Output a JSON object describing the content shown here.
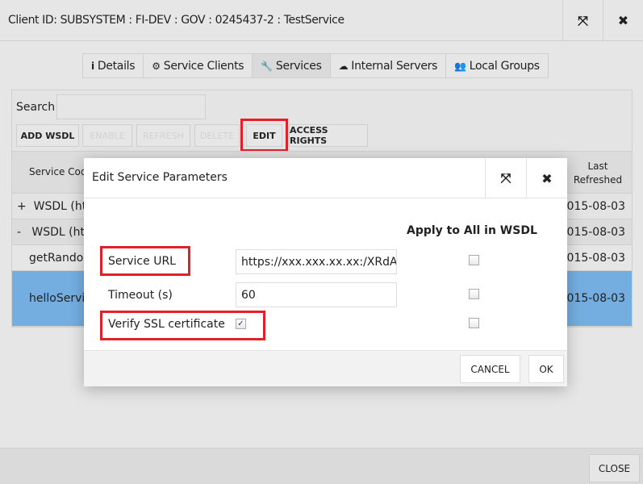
{
  "header": {
    "title_label": "Client ID:",
    "title_value": " SUBSYSTEM : FI-DEV : GOV : 0245437-2 : TestService",
    "maximize_icon": "expand-icon",
    "close_icon": "close-icon"
  },
  "tabs": [
    {
      "label": "Details",
      "icon": "info-icon",
      "glyph": "ℹ"
    },
    {
      "label": "Service Clients",
      "icon": "gears-icon",
      "glyph": "⚙"
    },
    {
      "label": "Services",
      "icon": "wrench-icon",
      "glyph": "🔧",
      "active": true
    },
    {
      "label": "Internal Servers",
      "icon": "cloud-icon",
      "glyph": "☁"
    },
    {
      "label": "Local Groups",
      "icon": "users-icon",
      "glyph": "👥"
    }
  ],
  "toolbar": {
    "search_label": "Search",
    "search_value": "",
    "add_wsdl": "ADD WSDL",
    "enable": "ENABLE",
    "refresh": "REFRESH",
    "delete": "DELETE",
    "edit": "EDIT",
    "access_rights": "ACCESS RIGHTS"
  },
  "table": {
    "columns": [
      "Service Code",
      "Last Refreshed"
    ],
    "rows": [
      {
        "prefix": "+",
        "name": "WSDL (htt",
        "refreshed": "015-08-03"
      },
      {
        "prefix": "-",
        "name": "WSDL (htt",
        "refreshed": "015-08-03"
      },
      {
        "prefix": "",
        "name": "getRandor",
        "refreshed": "015-08-03"
      },
      {
        "prefix": "",
        "name": "helloServi",
        "refreshed": "015-08-03",
        "selected": true
      }
    ]
  },
  "modal": {
    "title": "Edit Service Parameters",
    "apply_header": "Apply to All in WSDL",
    "service_url_label": "Service URL",
    "service_url_value": "https://xxx.xxx.xx.xx:/XRdA",
    "timeout_label": "Timeout (s)",
    "timeout_value": "60",
    "verify_ssl_label": "Verify SSL certificate",
    "verify_ssl_checked": true,
    "apply_url_checked": false,
    "apply_timeout_checked": false,
    "apply_ssl_checked": false,
    "cancel": "CANCEL",
    "ok": "OK"
  },
  "footer": {
    "close": "CLOSE"
  },
  "colors": {
    "highlight": "#e3202a",
    "selected_row": "#74aee0"
  }
}
